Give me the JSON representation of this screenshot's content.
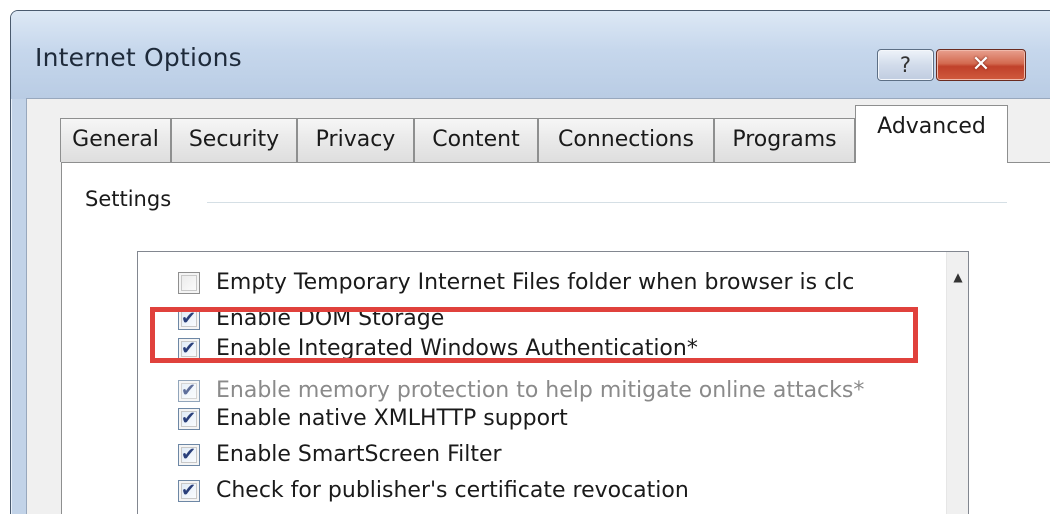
{
  "window": {
    "title": "Internet Options",
    "help_glyph": "?",
    "close_glyph": "✕"
  },
  "tabs": [
    {
      "label": "General"
    },
    {
      "label": "Security"
    },
    {
      "label": "Privacy"
    },
    {
      "label": "Content"
    },
    {
      "label": "Connections"
    },
    {
      "label": "Programs"
    },
    {
      "label": "Advanced",
      "selected": true
    }
  ],
  "settings": {
    "group_label": "Settings",
    "scroll_up_glyph": "▲",
    "items": [
      {
        "label": "Empty Temporary Internet Files folder when browser is clc",
        "checked": false
      },
      {
        "label": "Enable DOM Storage",
        "checked": true
      },
      {
        "label": "Enable Integrated Windows Authentication*",
        "checked": true,
        "highlighted": true
      },
      {
        "label": "Enable memory protection to help mitigate online attacks*",
        "checked": true,
        "disabled": true
      },
      {
        "label": "Enable native XMLHTTP support",
        "checked": true
      },
      {
        "label": "Enable SmartScreen Filter",
        "checked": true
      },
      {
        "label": "Check for publisher's certificate revocation",
        "checked": true
      }
    ]
  },
  "colors": {
    "highlight_border": "#e0413c",
    "titlebar": "#c6d7ec",
    "close_button": "#c0412a"
  }
}
